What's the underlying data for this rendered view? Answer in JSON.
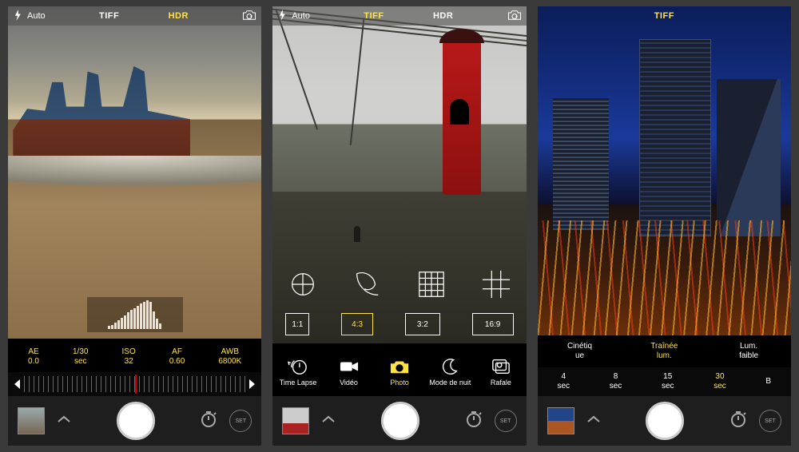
{
  "topbar": {
    "flash_label": "Auto",
    "tabs": [
      "TIFF",
      "HDR"
    ],
    "switch_icon": "camera-switch-icon"
  },
  "panel1": {
    "selected_tab": "HDR",
    "exposure": {
      "ae_label": "AE",
      "ae_value": "0.0",
      "shutter_value": "1/30",
      "shutter_unit": "sec",
      "iso_label": "ISO",
      "iso_value": "32",
      "af_label": "AF",
      "af_value": "0.60",
      "awb_label": "AWB",
      "awb_value": "6800K"
    }
  },
  "panel2": {
    "selected_tab": "TIFF",
    "tools": {
      "row1": [
        "crosshair-icon",
        "spiral-icon",
        "grid-fine-icon",
        "grid-thirds-icon"
      ],
      "ratios": [
        "1:1",
        "4:3",
        "3:2",
        "16:9"
      ],
      "selected_ratio": "4:3"
    },
    "modes": {
      "items": [
        {
          "icon": "clock-back-icon",
          "label": "Time Lapse"
        },
        {
          "icon": "video-icon",
          "label": "Vidéo"
        },
        {
          "icon": "camera-icon",
          "label": "Photo"
        },
        {
          "icon": "moon-icon",
          "label": "Mode de nuit"
        },
        {
          "icon": "burst-icon",
          "label": "Rafale"
        }
      ],
      "selected": "Photo"
    }
  },
  "panel3": {
    "top_label": "TIFF",
    "light_modes": {
      "items": [
        "Cinétiq\nue",
        "Traînée\nlum.",
        "Lum.\nfaible"
      ],
      "selected": 1
    },
    "durations": {
      "items": [
        {
          "value": "4",
          "unit": "sec"
        },
        {
          "value": "8",
          "unit": "sec"
        },
        {
          "value": "15",
          "unit": "sec"
        },
        {
          "value": "30",
          "unit": "sec"
        },
        {
          "value": "B",
          "unit": ""
        }
      ],
      "selected": 3
    }
  },
  "shutter_bar": {
    "set_label": "SET"
  }
}
